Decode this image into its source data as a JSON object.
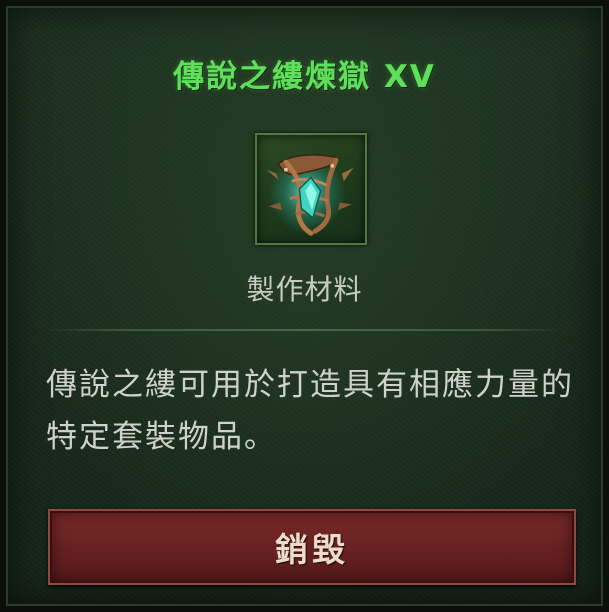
{
  "tooltip": {
    "title": "傳說之縷煉獄 XV",
    "item_icon": "legendary-thread-icon",
    "item_type": "製作材料",
    "description": "傳說之縷可用於打造具有相應力量的特定套裝物品。",
    "destroy_label": "銷毀"
  },
  "colors": {
    "title": "#5fe05a",
    "panel_bg": "#1a2c1d",
    "button_bg": "#6a2322"
  }
}
